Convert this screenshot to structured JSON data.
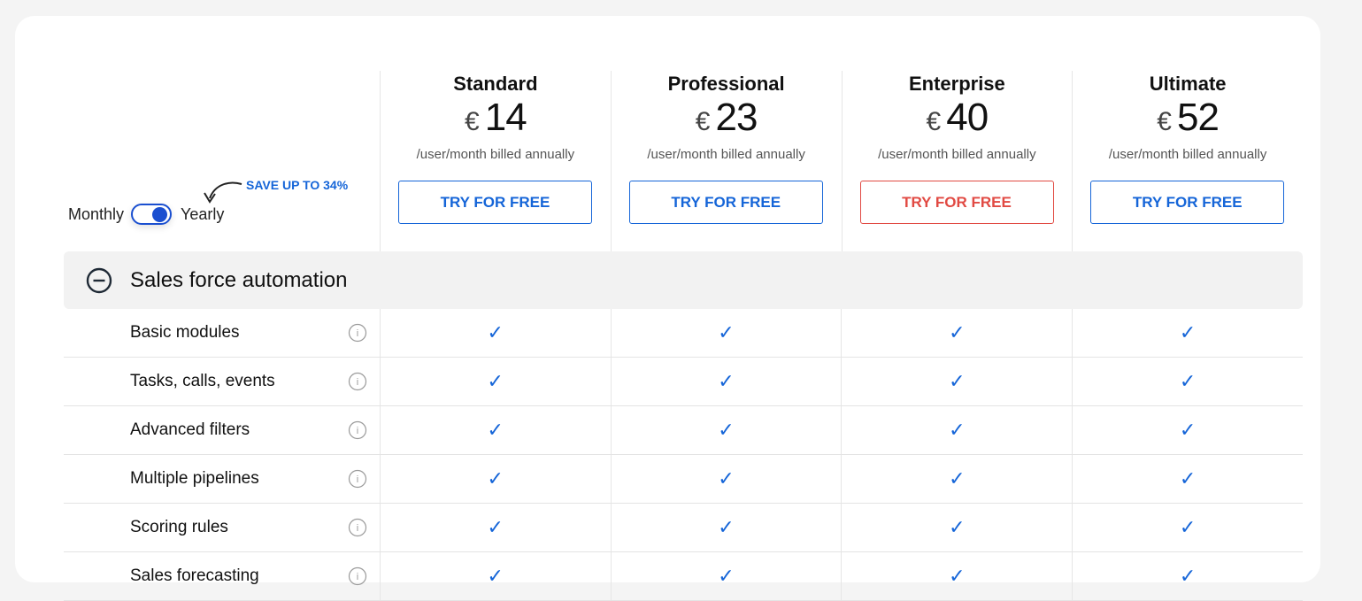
{
  "billing_toggle": {
    "monthly_label": "Monthly",
    "yearly_label": "Yearly",
    "selected": "Yearly",
    "save_badge": "SAVE UP TO 34%"
  },
  "plans": [
    {
      "name": "Standard",
      "currency": "€",
      "price": "14",
      "billing": "/user/month billed annually",
      "cta": "TRY FOR FREE"
    },
    {
      "name": "Professional",
      "currency": "€",
      "price": "23",
      "billing": "/user/month billed annually",
      "cta": "TRY FOR FREE"
    },
    {
      "name": "Enterprise",
      "currency": "€",
      "price": "40",
      "billing": "/user/month billed annually",
      "cta": "TRY FOR FREE"
    },
    {
      "name": "Ultimate",
      "currency": "€",
      "price": "52",
      "billing": "/user/month billed annually",
      "cta": "TRY FOR FREE"
    }
  ],
  "section": {
    "title": "Sales force automation",
    "icon": "minus-circle-icon"
  },
  "features": [
    {
      "label": "Basic modules",
      "check": "✓"
    },
    {
      "label": "Tasks, calls, events",
      "check": "✓"
    },
    {
      "label": "Advanced filters",
      "check": "✓"
    },
    {
      "label": "Multiple pipelines",
      "check": "✓"
    },
    {
      "label": "Scoring rules",
      "check": "✓"
    },
    {
      "label": "Sales forecasting",
      "check": "✓"
    }
  ],
  "colors": {
    "accent": "#1565d8",
    "enterprise_accent": "#e14a43",
    "section_bg": "#f2f2f2"
  }
}
